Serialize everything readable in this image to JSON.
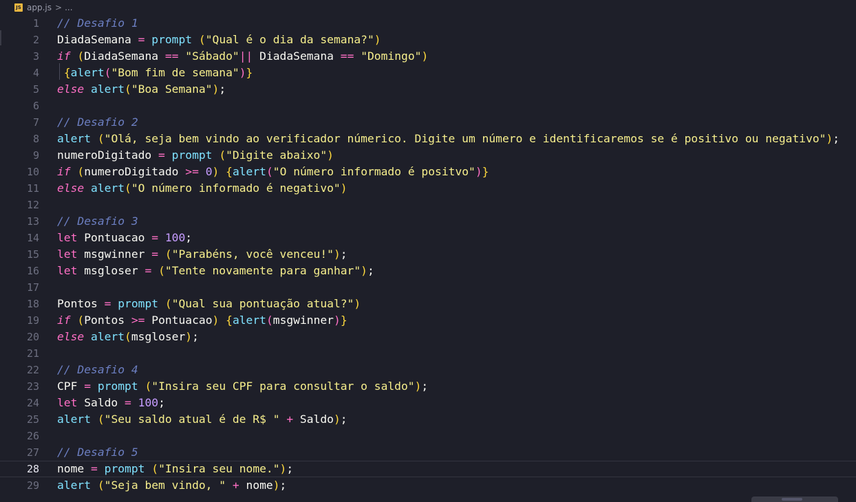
{
  "breadcrumb": {
    "icon": "js-file-icon",
    "icon_text": "JS",
    "file": "app.js",
    "separator": ">",
    "more": "..."
  },
  "editor": {
    "current_line": 28,
    "lines": [
      {
        "n": "1",
        "tokens": [
          [
            "com",
            "// Desafio 1"
          ]
        ]
      },
      {
        "n": "2",
        "tokens": [
          [
            "id",
            "DiadaSemana "
          ],
          [
            "op",
            "="
          ],
          [
            "ws",
            " "
          ],
          [
            "fn",
            "prompt"
          ],
          [
            "ws",
            " "
          ],
          [
            "p1",
            "("
          ],
          [
            "str",
            "\"Qual é o dia da semana?\""
          ],
          [
            "p1",
            ")"
          ]
        ]
      },
      {
        "n": "3",
        "tokens": [
          [
            "kw",
            "if"
          ],
          [
            "ws",
            " "
          ],
          [
            "p1",
            "("
          ],
          [
            "id",
            "DiadaSemana "
          ],
          [
            "op",
            "=="
          ],
          [
            "ws",
            " "
          ],
          [
            "str",
            "\"Sábado\""
          ],
          [
            "op",
            "||"
          ],
          [
            "ws",
            " "
          ],
          [
            "id",
            "DiadaSemana "
          ],
          [
            "op",
            "=="
          ],
          [
            "ws",
            " "
          ],
          [
            "str",
            "\"Domingo\""
          ],
          [
            "p1",
            ")"
          ]
        ]
      },
      {
        "n": "4",
        "tokens": [
          [
            "ws",
            " "
          ],
          [
            "p1",
            "{"
          ],
          [
            "fn",
            "alert"
          ],
          [
            "p2",
            "("
          ],
          [
            "str",
            "\"Bom fim de semana\""
          ],
          [
            "p2",
            ")"
          ],
          [
            "p1",
            "}"
          ]
        ]
      },
      {
        "n": "5",
        "tokens": [
          [
            "kw",
            "else"
          ],
          [
            "ws",
            " "
          ],
          [
            "fn",
            "alert"
          ],
          [
            "p1",
            "("
          ],
          [
            "str",
            "\"Boa Semana\""
          ],
          [
            "p1",
            ")"
          ],
          [
            "id",
            ";"
          ]
        ]
      },
      {
        "n": "6",
        "tokens": []
      },
      {
        "n": "7",
        "tokens": [
          [
            "com",
            "// Desafio 2"
          ]
        ]
      },
      {
        "n": "8",
        "tokens": [
          [
            "fn",
            "alert"
          ],
          [
            "ws",
            " "
          ],
          [
            "p1",
            "("
          ],
          [
            "str",
            "\"Olá, seja bem vindo ao verificador númerico. Digite um número e identificaremos se é positivo ou negativo\""
          ],
          [
            "p1",
            ")"
          ],
          [
            "id",
            ";"
          ]
        ]
      },
      {
        "n": "9",
        "tokens": [
          [
            "id",
            "numeroDigitado "
          ],
          [
            "op",
            "="
          ],
          [
            "ws",
            " "
          ],
          [
            "fn",
            "prompt"
          ],
          [
            "ws",
            " "
          ],
          [
            "p1",
            "("
          ],
          [
            "str",
            "\"Digite abaixo\""
          ],
          [
            "p1",
            ")"
          ]
        ]
      },
      {
        "n": "10",
        "tokens": [
          [
            "kw",
            "if"
          ],
          [
            "ws",
            " "
          ],
          [
            "p1",
            "("
          ],
          [
            "id",
            "numeroDigitado "
          ],
          [
            "op",
            ">="
          ],
          [
            "ws",
            " "
          ],
          [
            "num",
            "0"
          ],
          [
            "p1",
            ")"
          ],
          [
            "ws",
            " "
          ],
          [
            "p1",
            "{"
          ],
          [
            "fn",
            "alert"
          ],
          [
            "p2",
            "("
          ],
          [
            "str",
            "\"O número informado é positvo\""
          ],
          [
            "p2",
            ")"
          ],
          [
            "p1",
            "}"
          ]
        ]
      },
      {
        "n": "11",
        "tokens": [
          [
            "kw",
            "else"
          ],
          [
            "ws",
            " "
          ],
          [
            "fn",
            "alert"
          ],
          [
            "p1",
            "("
          ],
          [
            "str",
            "\"O número informado é negativo\""
          ],
          [
            "p1",
            ")"
          ]
        ]
      },
      {
        "n": "12",
        "tokens": []
      },
      {
        "n": "13",
        "tokens": [
          [
            "com",
            "// Desafio 3"
          ]
        ]
      },
      {
        "n": "14",
        "tokens": [
          [
            "let",
            "let"
          ],
          [
            "id",
            " Pontuacao "
          ],
          [
            "op",
            "="
          ],
          [
            "ws",
            " "
          ],
          [
            "num",
            "100"
          ],
          [
            "id",
            ";"
          ]
        ]
      },
      {
        "n": "15",
        "tokens": [
          [
            "let",
            "let"
          ],
          [
            "id",
            " msgwinner "
          ],
          [
            "op",
            "="
          ],
          [
            "ws",
            " "
          ],
          [
            "p1",
            "("
          ],
          [
            "str",
            "\"Parabéns, você venceu!\""
          ],
          [
            "p1",
            ")"
          ],
          [
            "id",
            ";"
          ]
        ]
      },
      {
        "n": "16",
        "tokens": [
          [
            "let",
            "let"
          ],
          [
            "id",
            " msgloser "
          ],
          [
            "op",
            "="
          ],
          [
            "ws",
            " "
          ],
          [
            "p1",
            "("
          ],
          [
            "str",
            "\"Tente novamente para ganhar\""
          ],
          [
            "p1",
            ")"
          ],
          [
            "id",
            ";"
          ]
        ]
      },
      {
        "n": "17",
        "tokens": []
      },
      {
        "n": "18",
        "tokens": [
          [
            "id",
            "Pontos "
          ],
          [
            "op",
            "="
          ],
          [
            "ws",
            " "
          ],
          [
            "fn",
            "prompt"
          ],
          [
            "ws",
            " "
          ],
          [
            "p1",
            "("
          ],
          [
            "str",
            "\"Qual sua pontuação atual?\""
          ],
          [
            "p1",
            ")"
          ]
        ]
      },
      {
        "n": "19",
        "tokens": [
          [
            "kw",
            "if"
          ],
          [
            "ws",
            " "
          ],
          [
            "p1",
            "("
          ],
          [
            "id",
            "Pontos "
          ],
          [
            "op",
            ">="
          ],
          [
            "id",
            " Pontuacao"
          ],
          [
            "p1",
            ")"
          ],
          [
            "ws",
            " "
          ],
          [
            "p1",
            "{"
          ],
          [
            "fn",
            "alert"
          ],
          [
            "p2",
            "("
          ],
          [
            "id",
            "msgwinner"
          ],
          [
            "p2",
            ")"
          ],
          [
            "p1",
            "}"
          ]
        ]
      },
      {
        "n": "20",
        "tokens": [
          [
            "kw",
            "else"
          ],
          [
            "ws",
            " "
          ],
          [
            "fn",
            "alert"
          ],
          [
            "p1",
            "("
          ],
          [
            "id",
            "msgloser"
          ],
          [
            "p1",
            ")"
          ],
          [
            "id",
            ";"
          ]
        ]
      },
      {
        "n": "21",
        "tokens": []
      },
      {
        "n": "22",
        "tokens": [
          [
            "com",
            "// Desafio 4"
          ]
        ]
      },
      {
        "n": "23",
        "tokens": [
          [
            "id",
            "CPF "
          ],
          [
            "op",
            "="
          ],
          [
            "ws",
            " "
          ],
          [
            "fn",
            "prompt"
          ],
          [
            "ws",
            " "
          ],
          [
            "p1",
            "("
          ],
          [
            "str",
            "\"Insira seu CPF para consultar o saldo\""
          ],
          [
            "p1",
            ")"
          ],
          [
            "id",
            ";"
          ]
        ]
      },
      {
        "n": "24",
        "tokens": [
          [
            "let",
            "let"
          ],
          [
            "id",
            " Saldo "
          ],
          [
            "op",
            "="
          ],
          [
            "ws",
            " "
          ],
          [
            "num",
            "100"
          ],
          [
            "id",
            ";"
          ]
        ]
      },
      {
        "n": "25",
        "tokens": [
          [
            "fn",
            "alert"
          ],
          [
            "ws",
            " "
          ],
          [
            "p1",
            "("
          ],
          [
            "str",
            "\"Seu saldo atual é de R$ \""
          ],
          [
            "ws",
            " "
          ],
          [
            "op",
            "+"
          ],
          [
            "id",
            " Saldo"
          ],
          [
            "p1",
            ")"
          ],
          [
            "id",
            ";"
          ]
        ]
      },
      {
        "n": "26",
        "tokens": []
      },
      {
        "n": "27",
        "tokens": [
          [
            "com",
            "// Desafio 5"
          ]
        ]
      },
      {
        "n": "28",
        "tokens": [
          [
            "id",
            "nome "
          ],
          [
            "op",
            "="
          ],
          [
            "ws",
            " "
          ],
          [
            "fn",
            "prompt"
          ],
          [
            "ws",
            " "
          ],
          [
            "p1",
            "("
          ],
          [
            "str",
            "\"Insira seu nome.\""
          ],
          [
            "p1",
            ")"
          ],
          [
            "id",
            ";"
          ]
        ]
      },
      {
        "n": "29",
        "tokens": [
          [
            "fn",
            "alert"
          ],
          [
            "ws",
            " "
          ],
          [
            "p1",
            "("
          ],
          [
            "str",
            "\"Seja bem vindo, \""
          ],
          [
            "ws",
            " "
          ],
          [
            "op",
            "+"
          ],
          [
            "id",
            " nome"
          ],
          [
            "p1",
            ")"
          ],
          [
            "id",
            ";"
          ]
        ]
      }
    ]
  }
}
